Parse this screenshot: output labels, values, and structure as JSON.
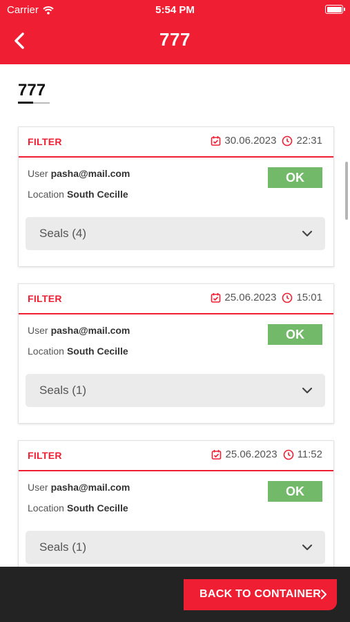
{
  "status_bar": {
    "carrier": "Carrier",
    "time": "5:54 PM"
  },
  "header": {
    "title": "777"
  },
  "page": {
    "heading": "777"
  },
  "records": [
    {
      "type": "FILTER",
      "date": "30.06.2023",
      "time": "22:31",
      "user_label": "User",
      "user": "pasha@mail.com",
      "location_label": "Location",
      "location": "South Cecille",
      "status": "OK",
      "seals": "Seals (4)"
    },
    {
      "type": "FILTER",
      "date": "25.06.2023",
      "time": "15:01",
      "user_label": "User",
      "user": "pasha@mail.com",
      "location_label": "Location",
      "location": "South Cecille",
      "status": "OK",
      "seals": "Seals (1)"
    },
    {
      "type": "FILTER",
      "date": "25.06.2023",
      "time": "11:52",
      "user_label": "User",
      "user": "pasha@mail.com",
      "location_label": "Location",
      "location": "South Cecille",
      "status": "OK",
      "seals": "Seals (1)"
    }
  ],
  "footer": {
    "back_button": "BACK TO CONTAINER"
  },
  "colors": {
    "accent": "#f01e32",
    "ok": "#72b96a",
    "footer_bg": "#232323",
    "seals_bg": "#ebebeb"
  },
  "icons": {
    "back": "chevron-left-icon",
    "wifi": "wifi-icon",
    "battery": "battery-icon",
    "calendar": "calendar-check-icon",
    "clock": "clock-icon",
    "expand": "chevron-down-icon",
    "forward": "chevron-right-icon"
  }
}
